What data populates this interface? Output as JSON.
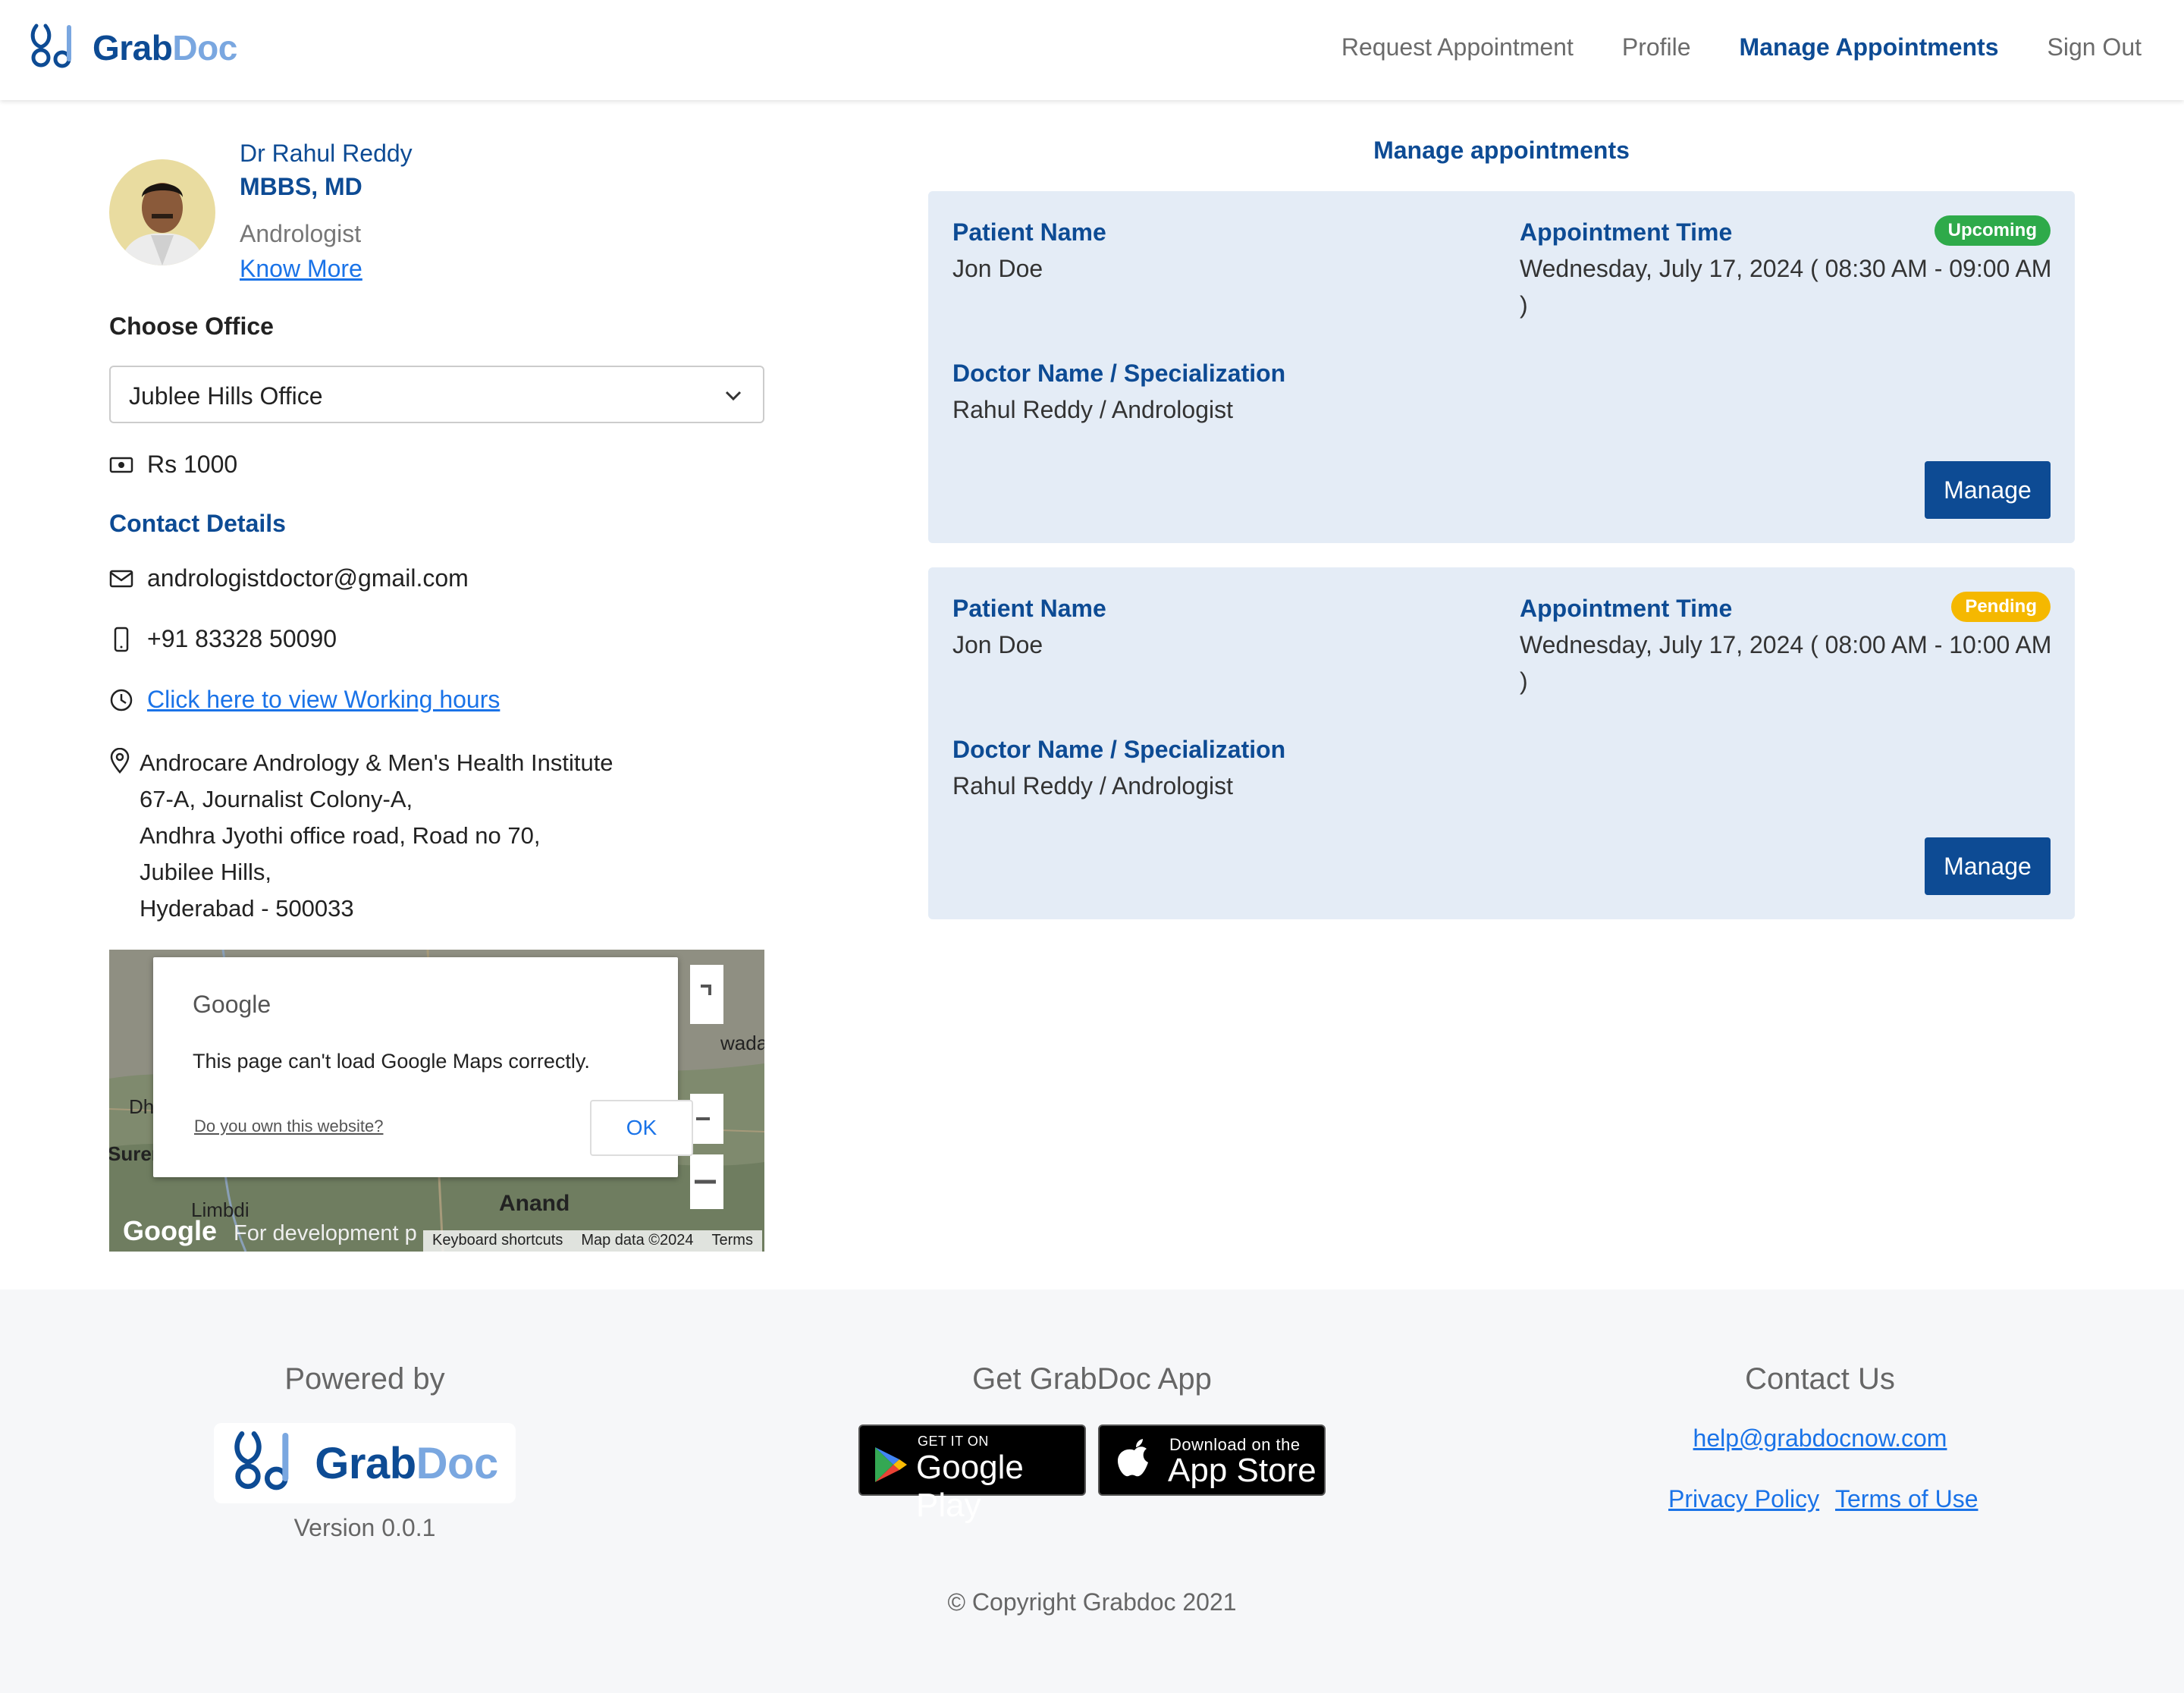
{
  "brand": {
    "part1": "Grab",
    "part2": "Doc"
  },
  "nav": {
    "request": "Request Appointment",
    "profile": "Profile",
    "manage": "Manage Appointments",
    "signout": "Sign Out"
  },
  "doctor": {
    "name": "Dr Rahul Reddy",
    "degree": "MBBS, MD",
    "specialization": "Andrologist",
    "know_more": "Know More"
  },
  "office": {
    "label": "Choose Office",
    "selected": "Jublee Hills Office",
    "fee": "Rs 1000"
  },
  "contact": {
    "title": "Contact Details",
    "email": "andrologistdoctor@gmail.com",
    "phone": "+91 83328 50090",
    "working_hours_link": "Click here to view Working hours",
    "address": [
      "Androcare Andrology & Men's Health Institute",
      "67-A, Journalist Colony-A,",
      "Andhra Jyothi office road, Road no 70,",
      "Jubilee Hills,",
      "Hyderabad - 500033"
    ]
  },
  "map": {
    "dialog_brand": "Google",
    "dialog_message": "This page can't load Google Maps correctly.",
    "dialog_own": "Do you own this website?",
    "dialog_ok": "OK",
    "watermark": "Google",
    "dev_text": "For development p",
    "footer_shortcuts": "Keyboard shortcuts",
    "footer_data": "Map data ©2024",
    "footer_terms": "Terms",
    "place_labels": [
      "Anand",
      "Limbdi",
      "Suren",
      "Dh",
      "wada"
    ]
  },
  "appointments": {
    "title": "Manage appointments",
    "labels": {
      "patient": "Patient Name",
      "time": "Appointment Time",
      "doctor": "Doctor Name / Specialization"
    },
    "items": [
      {
        "patient": "Jon Doe",
        "time_line1": "Wednesday, July 17, 2024 ( 08:30 AM - 09:00 AM",
        "time_line2": ")",
        "doctor": "Rahul Reddy / Andrologist",
        "status": "Upcoming",
        "status_color": "#2eaa4a",
        "button": "Manage"
      },
      {
        "patient": "Jon Doe",
        "time_line1": "Wednesday, July 17, 2024 ( 08:00 AM - 10:00 AM",
        "time_line2": ")",
        "doctor": "Rahul Reddy / Andrologist",
        "status": "Pending",
        "status_color": "#f5b800",
        "button": "Manage"
      }
    ]
  },
  "footer": {
    "powered_by": "Powered by",
    "version": "Version 0.0.1",
    "get_app": "Get GrabDoc App",
    "google_play_small": "GET IT ON",
    "google_play_big": "Google Play",
    "app_store_small": "Download on the",
    "app_store_big": "App Store",
    "contact_title": "Contact Us",
    "contact_email": "help@grabdocnow.com",
    "privacy": "Privacy Policy",
    "terms": "Terms of Use",
    "copyright": "© Copyright Grabdoc 2021"
  },
  "colors": {
    "primary": "#0d4b94",
    "link": "#1a73e8",
    "card_bg": "#e4ecf6"
  }
}
